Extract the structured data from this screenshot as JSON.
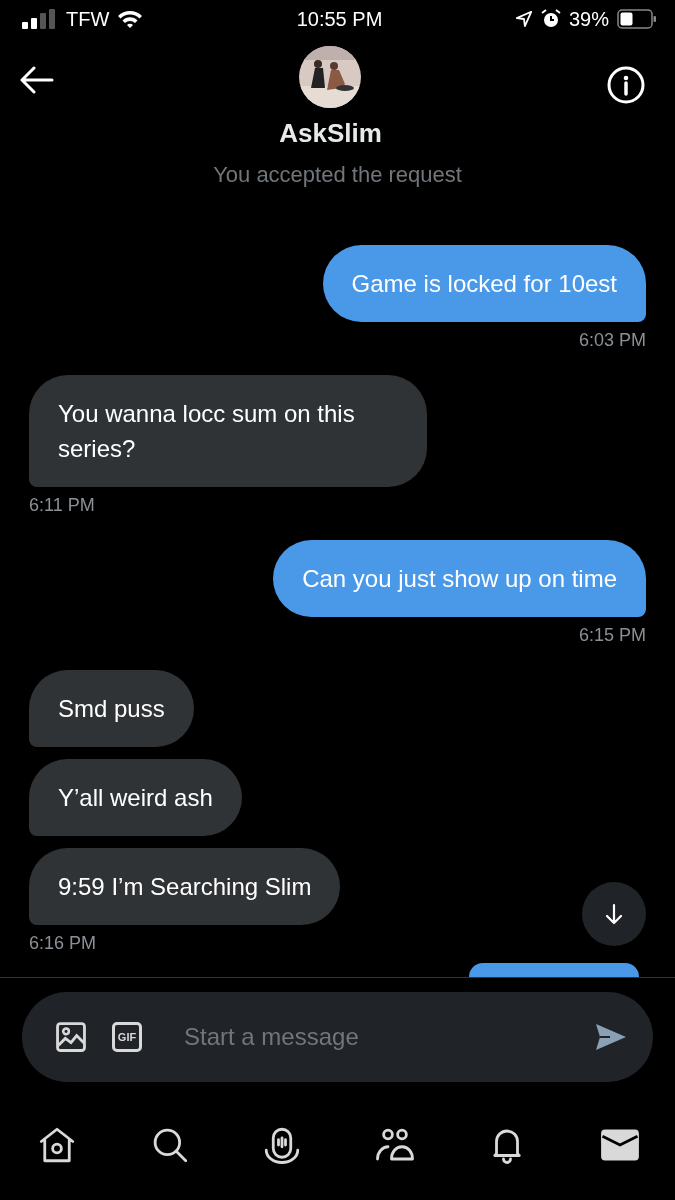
{
  "status_bar": {
    "carrier": "TFW",
    "time": "10:55 PM",
    "battery": "39%"
  },
  "header": {
    "name": "AskSlim"
  },
  "notice": "You accepted the request",
  "messages": [
    {
      "kind": "sent",
      "text": "Game is locked for 10est",
      "time": "6:03 PM"
    },
    {
      "kind": "received",
      "text": "You wanna locc sum on this series?",
      "time": "6:11 PM"
    },
    {
      "kind": "sent",
      "text": "Can you just show up on time",
      "time": "6:15 PM"
    },
    {
      "kind": "received",
      "text": "Smd puss"
    },
    {
      "kind": "received",
      "text": "Y’all weird ash"
    },
    {
      "kind": "received",
      "text": "9:59 I’m Searching Slim",
      "time": "6:16 PM"
    }
  ],
  "composer": {
    "gif_label": "GIF",
    "placeholder": "Start a message"
  },
  "nav": [
    {
      "kind": "home",
      "selected": false
    },
    {
      "kind": "search",
      "selected": false
    },
    {
      "kind": "spaces",
      "selected": false
    },
    {
      "kind": "communities",
      "selected": false
    },
    {
      "kind": "notifications",
      "selected": false
    },
    {
      "kind": "messages",
      "selected": true
    }
  ]
}
